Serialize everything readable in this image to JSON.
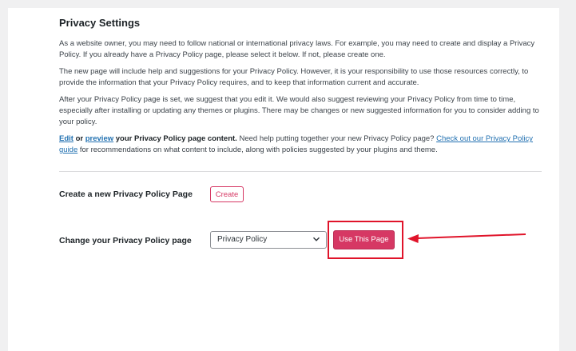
{
  "section": {
    "title": "Privacy Settings",
    "p1": "As a website owner, you may need to follow national or international privacy laws. For example, you may need to create and display a Privacy Policy. If you already have a Privacy Policy page, please select it below. If not, please create one.",
    "p2": "The new page will include help and suggestions for your Privacy Policy. However, it is your responsibility to use those resources correctly, to provide the information that your Privacy Policy requires, and to keep that information current and accurate.",
    "p3": "After your Privacy Policy page is set, we suggest that you edit it. We would also suggest reviewing your Privacy Policy from time to time, especially after installing or updating any themes or plugins. There may be changes or new suggested information for you to consider adding to your policy.",
    "p4": {
      "edit_link": "Edit",
      "or_text": " or ",
      "preview_link": "preview",
      "strong_rest": " your Privacy Policy page content.",
      "help_text": " Need help putting together your new Privacy Policy page? ",
      "guide_link": "Check out our Privacy Policy guide",
      "tail_text": " for recommendations on what content to include, along with policies suggested by your plugins and theme."
    }
  },
  "create_row": {
    "label": "Create a new Privacy Policy Page",
    "button_label": "Create"
  },
  "change_row": {
    "label": "Change your Privacy Policy page",
    "select_value": "Privacy Policy",
    "button_label": "Use This Page"
  },
  "colors": {
    "accent": "#d63864",
    "link": "#2271b1",
    "annotation": "#e0142a"
  },
  "icons": {
    "select_chevron": "chevron-down-icon",
    "annotation_arrow": "arrow-left-icon"
  }
}
